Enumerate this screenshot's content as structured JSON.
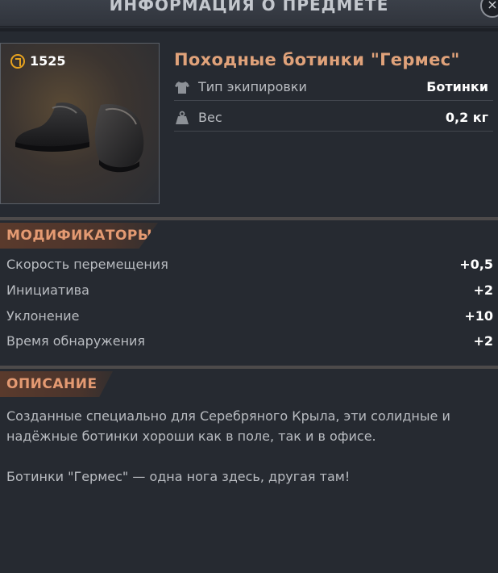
{
  "window": {
    "title": "ИНФОРМАЦИЯ О ПРЕДМЕТЕ",
    "close_label": "×"
  },
  "item": {
    "price": "1525",
    "name": "Походные ботинки \"Гермес\"",
    "stats": [
      {
        "icon": "shirt-icon",
        "label": "Тип экипировки",
        "value": "Ботинки"
      },
      {
        "icon": "weight-icon",
        "label": "Вес",
        "value": "0,2 кг"
      }
    ]
  },
  "modifiers": {
    "heading": "МОДИФИКАТОРЫ",
    "rows": [
      {
        "label": "Скорость перемещения",
        "value": "+0,5"
      },
      {
        "label": "Инициатива",
        "value": "+2"
      },
      {
        "label": "Уклонение",
        "value": "+10"
      },
      {
        "label": "Время обнаружения",
        "value": "+2"
      }
    ]
  },
  "description": {
    "heading": "ОПИСАНИЕ",
    "line1": "Созданные специально для Серебряного Крыла, эти солидные и",
    "line2": "надёжные ботинки хороши как в поле, так и в офисе.",
    "line3": "Ботинки \"Гермес\" — одна нога здесь, другая там!"
  },
  "colors": {
    "accent": "#e0a27a",
    "coin": "#e6a21f",
    "background": "#262a31"
  }
}
